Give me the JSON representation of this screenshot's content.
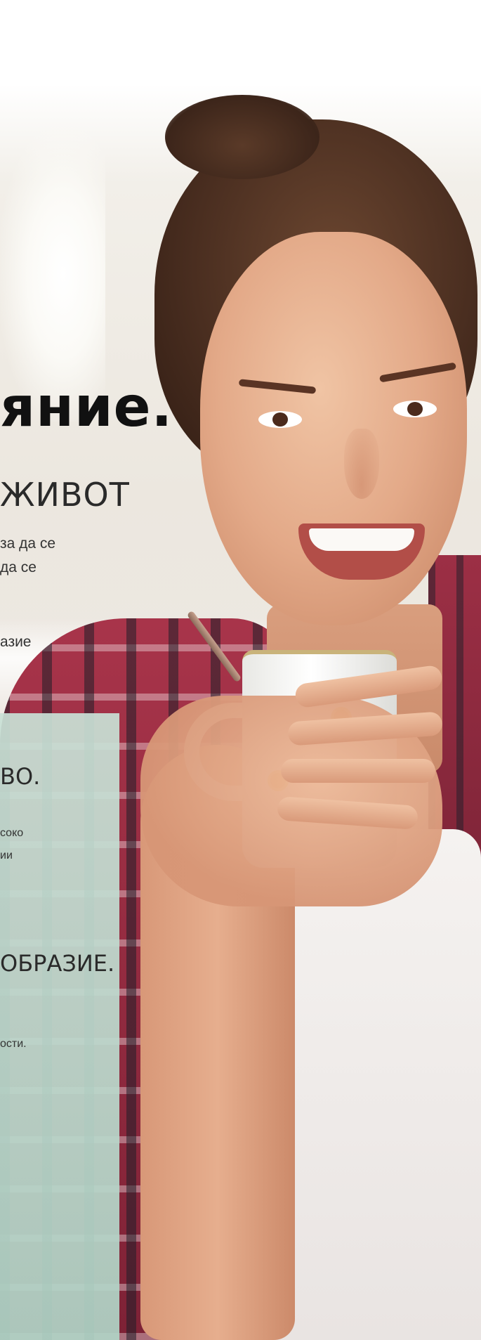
{
  "headline": "яние.",
  "subheadline": "ЖИВОТ",
  "intro_lines": [
    "за да се",
    "да се"
  ],
  "intro_tail": "азие",
  "section1": {
    "title": "ВО.",
    "lines": [
      "соко",
      "ии"
    ]
  },
  "section2": {
    "title": "ОБРАЗИЕ.",
    "lines": [
      "ости."
    ]
  },
  "colors": {
    "panel": "#c2ddd1",
    "heading": "#111111",
    "body": "#333333"
  }
}
